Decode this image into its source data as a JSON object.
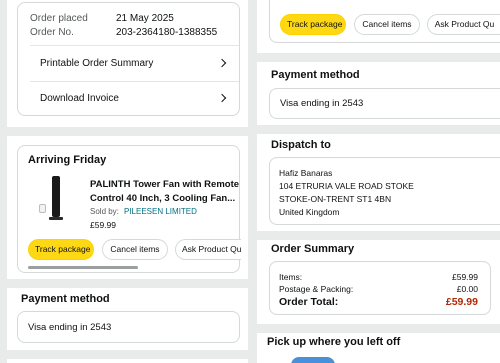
{
  "order_info": {
    "placed_label": "Order placed",
    "placed_value": "21 May 2025",
    "number_label": "Order No.",
    "number_value": "203-2364180-1388355",
    "links": [
      "Printable Order Summary",
      "Download Invoice"
    ]
  },
  "shipment": {
    "heading": "Arriving Friday",
    "title_line1": "PALINTH Tower Fan with Remote",
    "title_line2": "Control 40 Inch, 3 Cooling Fan...",
    "sold_by_label": "Sold by:",
    "seller": "PILEESEN LIMITED",
    "price": "£59.99",
    "buttons": [
      "Track package",
      "Cancel items",
      "Ask Product Qu"
    ]
  },
  "payment": {
    "heading": "Payment method",
    "card_text": "Visa  ending in 2543"
  },
  "dispatch": {
    "heading": "Dispatch to",
    "lines": [
      "Hafiz Banaras",
      "104 ETRURIA VALE ROAD STOKE",
      "STOKE-ON-TRENT ST1 4BN",
      "United Kingdom"
    ]
  },
  "summary": {
    "heading": "Order Summary",
    "items_label": "Items:",
    "items_value": "£59.99",
    "postage_label": "Postage & Packing:",
    "postage_value": "£0.00",
    "total_label": "Order Total:",
    "total_value": "£59.99"
  },
  "pickup": {
    "heading": "Pick up where you left off"
  },
  "colors": {
    "track_button": "#ffd814",
    "total_price": "#b12704",
    "seller_link": "#007185",
    "page_gap": "#e9eaea"
  }
}
